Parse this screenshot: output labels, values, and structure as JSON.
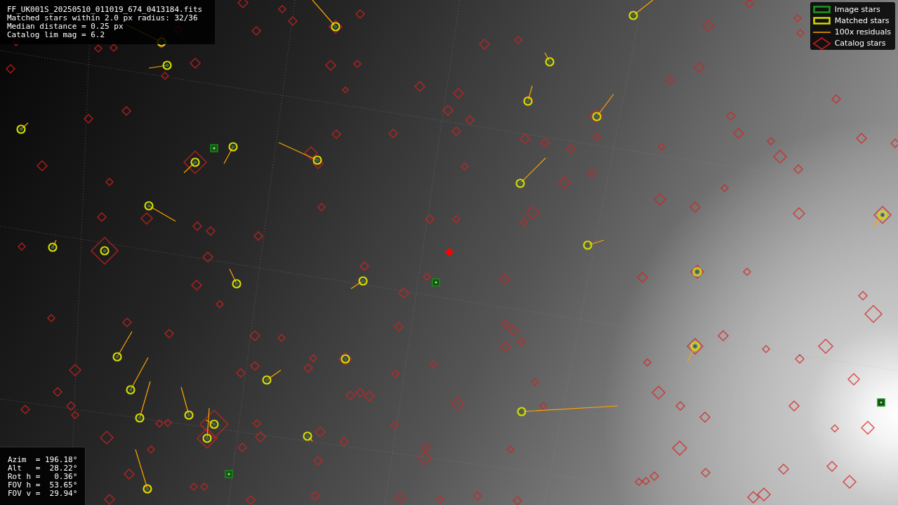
{
  "info_panel": {
    "lines": [
      "FF_UK001S_20250510_011019_674_0413184.fits",
      "Matched stars within 2.0 px radius: 32/36",
      "Median distance = 0.25 px",
      "Catalog lim mag = 6.2"
    ]
  },
  "legend": {
    "items": [
      {
        "kind": "image",
        "label": "Image stars"
      },
      {
        "kind": "matched",
        "label": "Matched stars"
      },
      {
        "kind": "residual",
        "label": "100x residuals"
      },
      {
        "kind": "catalog",
        "label": "Catalog stars"
      }
    ]
  },
  "pointing_panel": {
    "lines": [
      "Azim  = 196.18°",
      "Alt   =  28.22°",
      "Rot h =   0.36°",
      "FOV h =  53.65°",
      "FOV v =  29.94°"
    ]
  }
}
